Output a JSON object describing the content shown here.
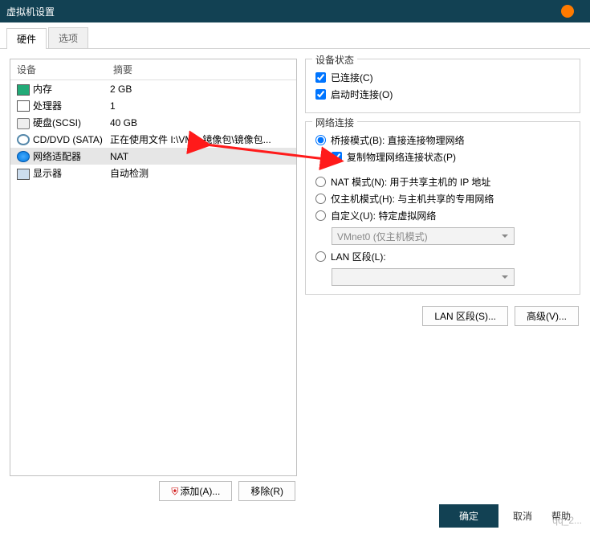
{
  "title": "虚拟机设置",
  "tabs": {
    "hardware": "硬件",
    "options": "选项"
  },
  "device_headers": {
    "device": "设备",
    "summary": "摘要"
  },
  "devices": [
    {
      "name": "内存",
      "summary": "2 GB",
      "icon": "mem"
    },
    {
      "name": "处理器",
      "summary": "1",
      "icon": "cpu"
    },
    {
      "name": "硬盘(SCSI)",
      "summary": "40 GB",
      "icon": "disk"
    },
    {
      "name": "CD/DVD (SATA)",
      "summary": "正在使用文件 I:\\VM、镜像包\\镜像包...",
      "icon": "cd"
    },
    {
      "name": "网络适配器",
      "summary": "NAT",
      "icon": "net",
      "selected": true
    },
    {
      "name": "显示器",
      "summary": "自动检测",
      "icon": "mon"
    }
  ],
  "dev_buttons": {
    "add": "添加(A)...",
    "remove": "移除(R)"
  },
  "status": {
    "legend": "设备状态",
    "connected": "已连接(C)",
    "connect_on_power": "启动时连接(O)"
  },
  "netconn": {
    "legend": "网络连接",
    "bridged": "桥接模式(B): 直接连接物理网络",
    "replicate": "复制物理网络连接状态(P)",
    "nat": "NAT 模式(N): 用于共享主机的 IP 地址",
    "hostonly": "仅主机模式(H): 与主机共享的专用网络",
    "custom": "自定义(U): 特定虚拟网络",
    "custom_value": "VMnet0 (仅主机模式)",
    "lan": "LAN 区段(L):",
    "lan_value": ""
  },
  "right_buttons": {
    "lanseg": "LAN 区段(S)...",
    "advanced": "高级(V)..."
  },
  "footer": {
    "ok": "确定",
    "cancel": "取消",
    "help": "帮助"
  },
  "watermark": "qq_2..."
}
